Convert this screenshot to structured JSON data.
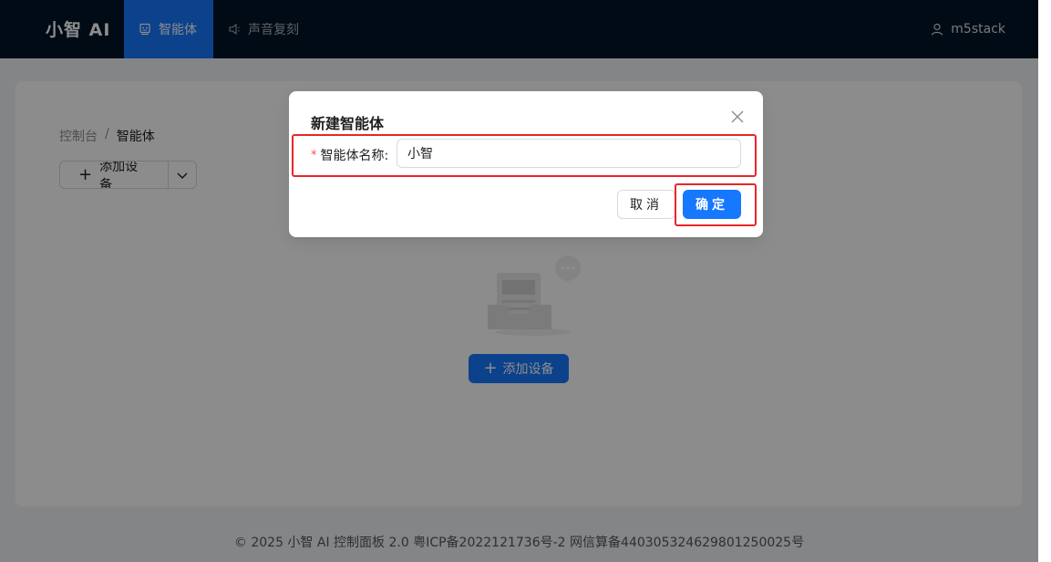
{
  "header": {
    "logo": "小智 AI",
    "nav": [
      {
        "label": "智能体",
        "icon": "robot-icon",
        "active": true
      },
      {
        "label": "声音复刻",
        "icon": "speaker-icon",
        "active": false
      }
    ],
    "user": {
      "icon": "user-icon",
      "name": "m5stack"
    }
  },
  "breadcrumb": {
    "root": "控制台",
    "separator": "/",
    "current": "智能体"
  },
  "toolbar": {
    "add_device_label": "添加设备",
    "dropdown_icon": "chevron-down-icon"
  },
  "empty_state": {
    "illustration": "empty-inbox-icon",
    "add_device_label": "添加设备"
  },
  "footer": {
    "text": "© 2025 小智 AI 控制面板 2.0 粤ICP备2022121736号-2 网信算备440305324629801250025号"
  },
  "modal": {
    "title": "新建智能体",
    "field_required_mark": "*",
    "field_label": "智能体名称:",
    "field_value": "小智",
    "cancel_label": "取消",
    "ok_label": "确定"
  },
  "colors": {
    "header_bg": "#001529",
    "primary": "#1677ff",
    "highlight": "#e8262a",
    "required": "#ff4d4f"
  }
}
